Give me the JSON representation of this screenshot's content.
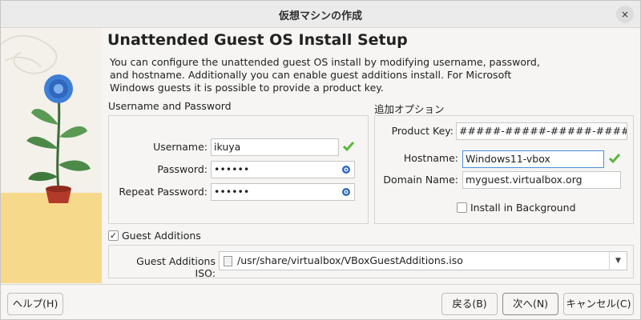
{
  "window": {
    "title": "仮想マシンの作成",
    "close_glyph": "×"
  },
  "page": {
    "heading": "Unattended Guest OS Install Setup",
    "description": "You can configure the unattended guest OS install by modifying username, password, and hostname. Additionally you can enable guest additions install. For Microsoft Windows guests it is possible to provide a product key."
  },
  "credentials": {
    "group_title": "Username and Password",
    "username_label": "Username:",
    "username_value": "ikuya",
    "password_label": "Password:",
    "password_value": "••••••",
    "repeat_label": "Repeat Password:",
    "repeat_value": "••••••"
  },
  "options": {
    "group_title": "追加オプション",
    "product_key_label": "Product Key:",
    "product_key_value": "#####-#####-#####-#####-#####",
    "hostname_label": "Hostname:",
    "hostname_value": "Windows11-vbox",
    "domain_label": "Domain Name:",
    "domain_value": "myguest.virtualbox.org",
    "background_label": "Install in Background",
    "background_checked": false
  },
  "guest_additions": {
    "checkbox_label": "Guest Additions",
    "checked": true,
    "check_glyph": "✓",
    "iso_label": "Guest Additions ISO:",
    "iso_path": "/usr/share/virtualbox/VBoxGuestAdditions.iso",
    "dropdown_glyph": "▼"
  },
  "buttons": {
    "help": "ヘルプ(H)",
    "back": "戻る(B)",
    "next": "次へ(N)",
    "cancel": "キャンセル(C)"
  },
  "icons": {
    "valid": "green-check-icon",
    "reveal": "eye-icon",
    "file": "file-icon",
    "close": "close-icon"
  },
  "colors": {
    "accent": "#4a90d9",
    "check_green": "#5db53b",
    "illustration_yellow": "#f7d98b",
    "flower_blue": "#3f7fd6"
  }
}
